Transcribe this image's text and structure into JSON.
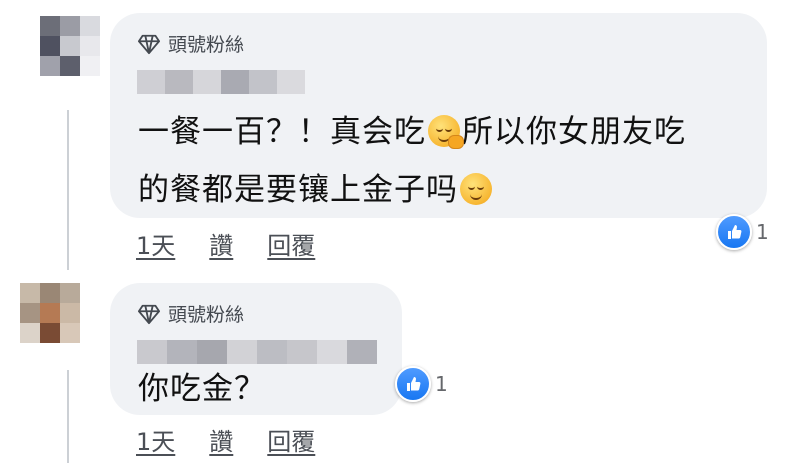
{
  "comments": [
    {
      "badge": "頭號粉絲",
      "text_line1": "一餐一百？！真会吃",
      "text_line1b": "所以你女朋友吃",
      "text_line2": "的餐都是要镶上金子吗",
      "emoji_1": "thinking-face-icon",
      "emoji_2": "relieved-face-icon",
      "like_count": "1",
      "actions": {
        "time": "1天",
        "like": "讚",
        "reply": "回覆"
      }
    },
    {
      "badge": "頭號粉絲",
      "text": "你吃金？",
      "like_count": "1",
      "actions": {
        "time": "1天",
        "like": "讚",
        "reply": "回覆"
      }
    }
  ],
  "colors": {
    "bubble": "#f0f2f5",
    "like": "#1877f2",
    "thread_line": "#ccd0d5"
  }
}
